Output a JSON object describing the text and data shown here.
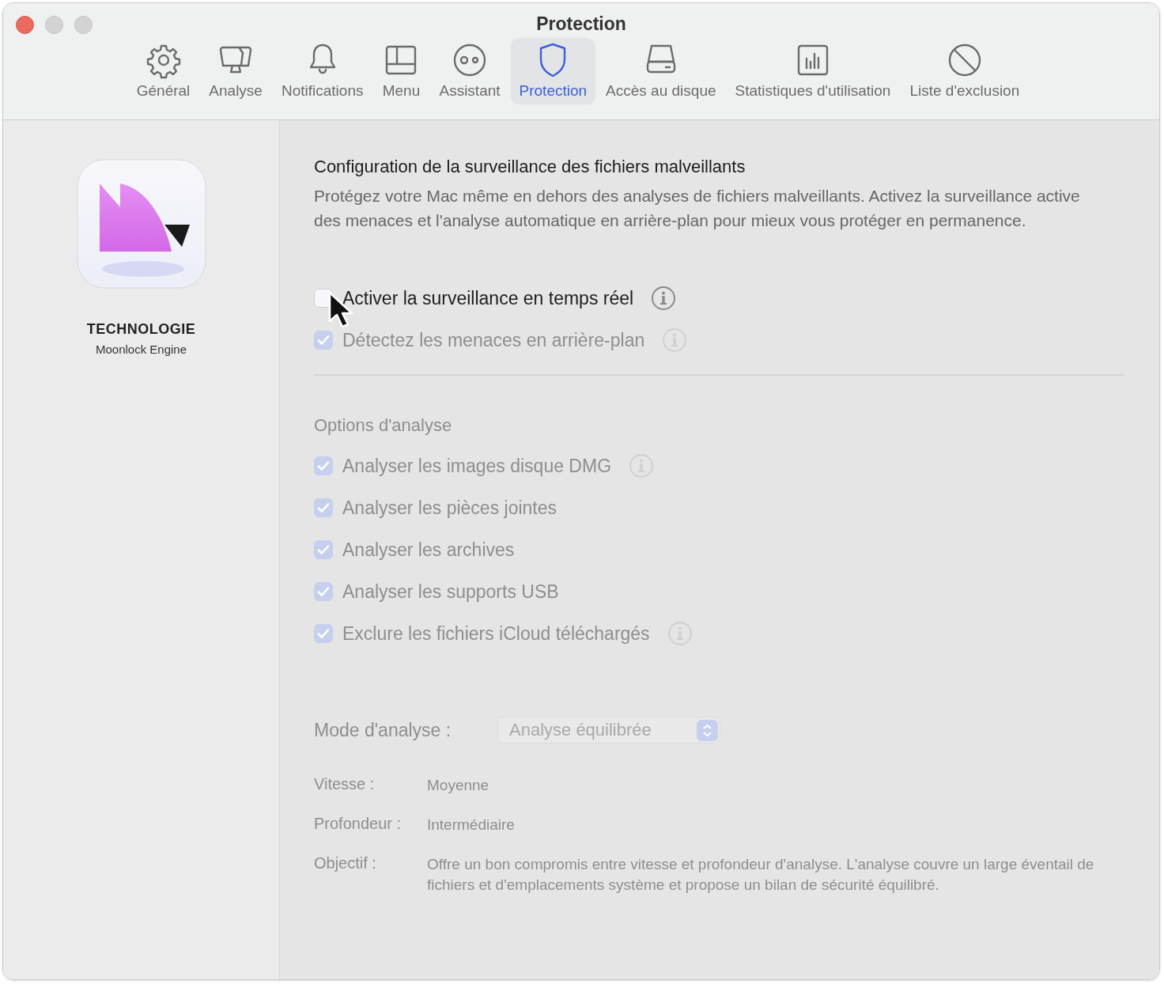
{
  "window": {
    "title": "Protection"
  },
  "toolbar": {
    "tabs": [
      {
        "label": "Général",
        "kind": "gear",
        "selected": false
      },
      {
        "label": "Analyse",
        "kind": "monitor",
        "selected": false
      },
      {
        "label": "Notifications",
        "kind": "bell",
        "selected": false
      },
      {
        "label": "Menu",
        "kind": "panel",
        "selected": false
      },
      {
        "label": "Assistant",
        "kind": "assistant",
        "selected": false
      },
      {
        "label": "Protection",
        "kind": "shield",
        "selected": true
      },
      {
        "label": "Accès au disque",
        "kind": "disk",
        "selected": false
      },
      {
        "label": "Statistiques d'utilisation",
        "kind": "chart",
        "selected": false
      },
      {
        "label": "Liste d'exclusion",
        "kind": "block",
        "selected": false
      }
    ]
  },
  "sidebar": {
    "heading": "TECHNOLOGIE",
    "subtitle": "Moonlock Engine"
  },
  "content": {
    "title": "Configuration de la surveillance des fichiers malveillants",
    "description": "Protégez votre Mac même en dehors des analyses de fichiers malveillants. Activez la surveillance active des menaces et l'analyse automatique en arrière-plan pour mieux vous protéger en permanence.",
    "realtime": [
      {
        "label": "Activer la surveillance en temps réel",
        "checked": false,
        "disabled": false,
        "info": true,
        "pointer": true
      },
      {
        "label": "Détectez les menaces en arrière-plan",
        "checked": true,
        "disabled": true,
        "info": true,
        "pointer": false
      }
    ],
    "options_heading": "Options d'analyse",
    "options_disabled": true,
    "options": [
      {
        "label": "Analyser les images disque DMG",
        "checked": true,
        "disabled": true,
        "info": true
      },
      {
        "label": "Analyser les pièces jointes",
        "checked": true,
        "disabled": true,
        "info": false
      },
      {
        "label": "Analyser les archives",
        "checked": true,
        "disabled": true,
        "info": false
      },
      {
        "label": "Analyser les supports USB",
        "checked": true,
        "disabled": true,
        "info": false
      },
      {
        "label": "Exclure les fichiers iCloud téléchargés",
        "checked": true,
        "disabled": true,
        "info": true
      }
    ],
    "mode": {
      "label": "Mode d'analyse :",
      "value": "Analyse équilibrée",
      "disabled": true
    },
    "details": [
      {
        "label": "Vitesse :",
        "value": "Moyenne"
      },
      {
        "label": "Profondeur :",
        "value": "Intermédiaire"
      },
      {
        "label": "Objectif :",
        "value": "Offre un bon compromis entre vitesse et profondeur d'analyse. L'analyse couvre un large éventail de fichiers et d'emplacements système et propose un bilan de sécurité équilibré."
      }
    ]
  }
}
